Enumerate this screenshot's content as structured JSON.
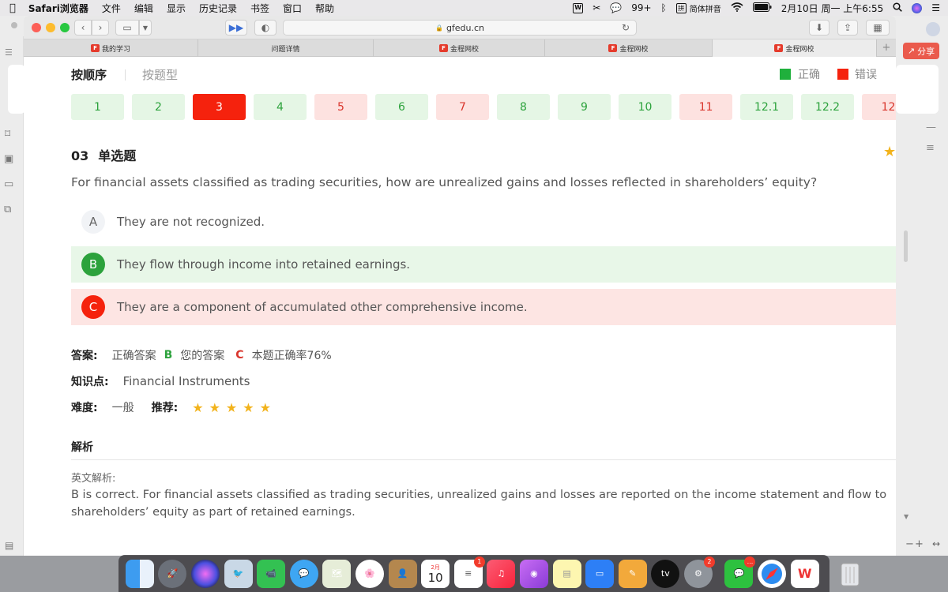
{
  "menubar": {
    "app_name": "Safari浏览器",
    "items": [
      "文件",
      "编辑",
      "显示",
      "历史记录",
      "书签",
      "窗口",
      "帮助"
    ],
    "wechat_badge": "99+",
    "input_method": "简体拼音",
    "datetime": "2月10日 周一 上午6:55"
  },
  "browser": {
    "url": "gfedu.cn",
    "tabs": [
      {
        "label": "我的学习",
        "favicon": true
      },
      {
        "label": "问题详情",
        "favicon": false
      },
      {
        "label": "金程网校",
        "favicon": true
      },
      {
        "label": "金程网校",
        "favicon": true
      },
      {
        "label": "金程网校",
        "favicon": true
      }
    ],
    "favicon_text": "F",
    "new_tab": "+"
  },
  "side_panel": {
    "share_label": "分享"
  },
  "page": {
    "sort_by_order": "按顺序",
    "sort_by_type": "按题型",
    "legend_correct": "正确",
    "legend_wrong": "错误",
    "legend_colors": {
      "correct": "#1fb03c",
      "wrong": "#f5220d"
    },
    "question_numbers": [
      {
        "label": "1",
        "state": "ok"
      },
      {
        "label": "2",
        "state": "ok"
      },
      {
        "label": "3",
        "state": "cur"
      },
      {
        "label": "4",
        "state": "ok"
      },
      {
        "label": "5",
        "state": "bad"
      },
      {
        "label": "6",
        "state": "ok"
      },
      {
        "label": "7",
        "state": "bad"
      },
      {
        "label": "8",
        "state": "ok"
      },
      {
        "label": "9",
        "state": "ok"
      },
      {
        "label": "10",
        "state": "ok"
      },
      {
        "label": "11",
        "state": "bad"
      },
      {
        "label": "12.1",
        "state": "ok"
      },
      {
        "label": "12.2",
        "state": "ok"
      },
      {
        "label": "12",
        "state": "bad"
      }
    ],
    "question_number": "03",
    "question_type": "单选题",
    "question_text": "For financial assets classified as trading securities, how are unrealized gains and losses reflected in shareholders’ equity?",
    "options": [
      {
        "letter": "A",
        "text": "They are not recognized."
      },
      {
        "letter": "B",
        "text": "They flow through income into retained earnings."
      },
      {
        "letter": "C",
        "text": "They are a component of accumulated other comprehensive income."
      }
    ],
    "answer_label": "答案:",
    "correct_answer_label": "正确答案",
    "correct_answer": "B",
    "your_answer_label": "您的答案",
    "your_answer": "C",
    "accuracy": "本题正确率76%",
    "knowledge_label": "知识点:",
    "knowledge": "Financial Instruments",
    "difficulty_label": "难度:",
    "difficulty": "一般",
    "recommend_label": "推荐:",
    "recommend_stars": 5,
    "analysis_title": "解析",
    "en_analysis_label": "英文解析:",
    "en_analysis_text": "B is correct. For financial assets classified as trading securities, unrealized gains and losses are reported on the income statement and flow to shareholders’ equity as part of retained earnings."
  },
  "dock": {
    "calendar_month": "2月",
    "calendar_day": "10",
    "reminders_badge": "1",
    "settings_badge": "2",
    "wechat_badge": "...",
    "tv_label": "tv"
  }
}
